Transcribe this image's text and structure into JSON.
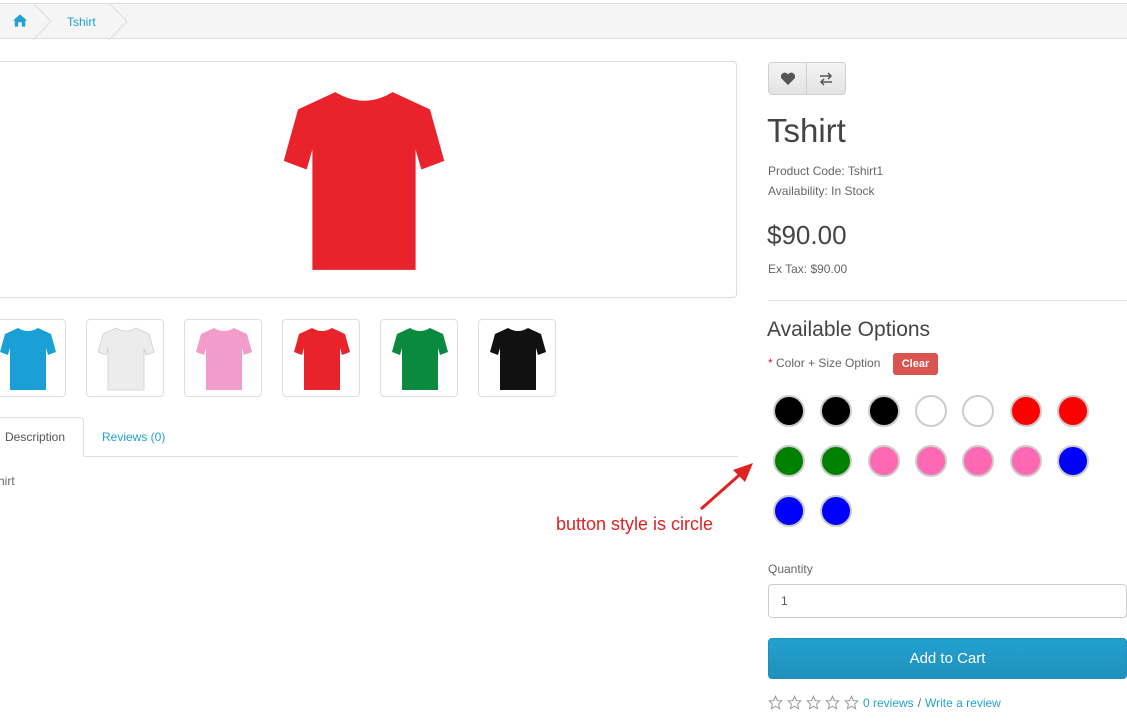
{
  "breadcrumb": {
    "home_icon": "home-icon",
    "items": [
      "Tshirt"
    ]
  },
  "product": {
    "title": "Tshirt",
    "code": "Product Code: Tshirt1",
    "availability": "Availability: In Stock",
    "price": "$90.00",
    "ex_tax": "Ex Tax: $90.00",
    "main_image_color": "#e8232b"
  },
  "actions": {
    "wishlist_icon": "heart-icon",
    "compare_icon": "exchange-icon"
  },
  "thumbnails": [
    {
      "color": "#1a9fd6"
    },
    {
      "color": "#ececec"
    },
    {
      "color": "#f29ccb"
    },
    {
      "color": "#e8232b"
    },
    {
      "color": "#0a8a3e"
    },
    {
      "color": "#111111"
    }
  ],
  "tabs": {
    "description": "Description",
    "reviews": "Reviews (0)",
    "content": "hirt"
  },
  "options": {
    "title": "Available Options",
    "star": "*",
    "label": "Color + Size Option",
    "clear": "Clear",
    "swatches": [
      "#000000",
      "#000000",
      "#000000",
      "#ffffff",
      "#ffffff",
      "#ff0000",
      "#ff0000",
      "#008000",
      "#008000",
      "#ff69b4",
      "#ff69b4",
      "#ff69b4",
      "#ff69b4",
      "#0000ff",
      "#0000ff",
      "#0000ff"
    ]
  },
  "annotation": "button style is circle",
  "quantity": {
    "label": "Quantity",
    "value": "1"
  },
  "cart_button": "Add to Cart",
  "reviews": {
    "stars": 0,
    "count_link": "0 reviews",
    "separator": "/",
    "write_link": "Write a review"
  }
}
